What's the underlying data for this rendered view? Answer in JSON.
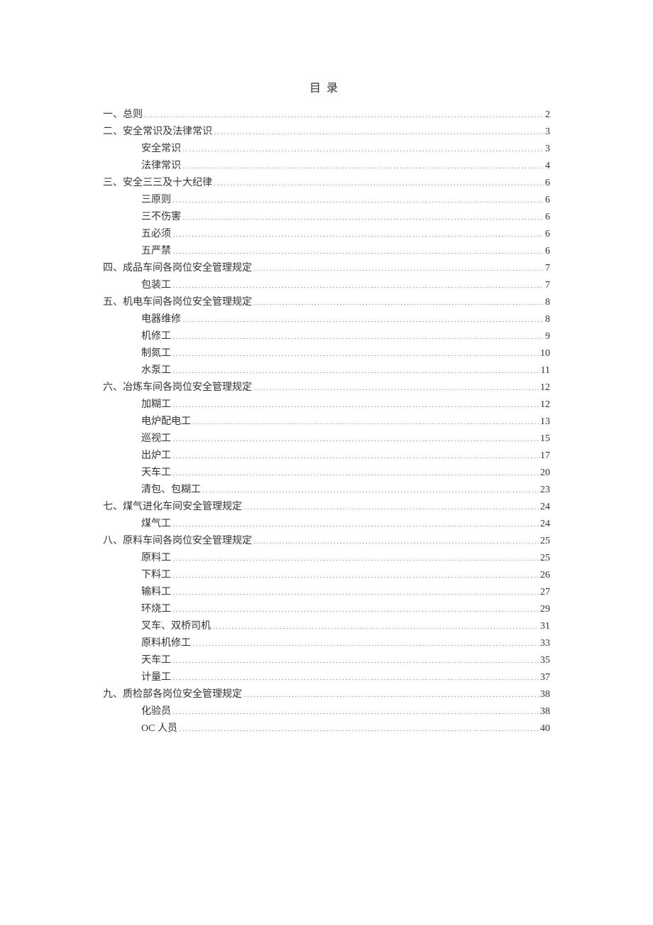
{
  "title": "目录",
  "entries": [
    {
      "level": 1,
      "prefix": "一、",
      "label": "总则",
      "page": "2"
    },
    {
      "level": 1,
      "prefix": "二、",
      "label": "安全常识及法律常识",
      "page": "3"
    },
    {
      "level": 2,
      "prefix": "",
      "label": "安全常识",
      "page": "3"
    },
    {
      "level": 2,
      "prefix": "",
      "label": "法律常识",
      "page": "4"
    },
    {
      "level": 1,
      "prefix": "三、",
      "label": "安全三三及十大纪律",
      "page": "6"
    },
    {
      "level": 2,
      "prefix": "",
      "label": "三原则",
      "page": "6"
    },
    {
      "level": 2,
      "prefix": "",
      "label": "三不伤害",
      "page": "6"
    },
    {
      "level": 2,
      "prefix": "",
      "label": "五必须",
      "page": "6"
    },
    {
      "level": 2,
      "prefix": "",
      "label": "五严禁",
      "page": "6"
    },
    {
      "level": 1,
      "prefix": "四、",
      "label": "成品车间各岗位安全管理规定",
      "page": "7"
    },
    {
      "level": 2,
      "prefix": "",
      "label": "包装工",
      "page": "7"
    },
    {
      "level": 1,
      "prefix": "五、",
      "label": "机电车间各岗位安全管理规定",
      "page": "8"
    },
    {
      "level": 2,
      "prefix": "",
      "label": "电器维修",
      "page": "8"
    },
    {
      "level": 2,
      "prefix": "",
      "label": "机修工",
      "page": "9"
    },
    {
      "level": 2,
      "prefix": "",
      "label": "制氮工",
      "page": "10"
    },
    {
      "level": 2,
      "prefix": "",
      "label": "水泵工",
      "page": "11"
    },
    {
      "level": 1,
      "prefix": "六、",
      "label": "冶炼车间各岗位安全管理规定",
      "page": "12"
    },
    {
      "level": 2,
      "prefix": "",
      "label": "加糊工",
      "page": "12"
    },
    {
      "level": 2,
      "prefix": "",
      "label": "电炉配电工",
      "page": "13"
    },
    {
      "level": 2,
      "prefix": "",
      "label": "巡视工",
      "page": "15"
    },
    {
      "level": 2,
      "prefix": "",
      "label": "出炉工",
      "page": "17"
    },
    {
      "level": 2,
      "prefix": "",
      "label": "天车工",
      "page": "20"
    },
    {
      "level": 2,
      "prefix": "",
      "label": "清包、包糊工",
      "page": "23"
    },
    {
      "level": 1,
      "prefix": "七、",
      "label": "煤气进化车间安全管理规定",
      "page": "24"
    },
    {
      "level": 2,
      "prefix": "",
      "label": "煤气工",
      "page": "24"
    },
    {
      "level": 1,
      "prefix": "八、",
      "label": "原料车间各岗位安全管理规定",
      "page": "25"
    },
    {
      "level": 2,
      "prefix": "",
      "label": "原料工",
      "page": "25"
    },
    {
      "level": 2,
      "prefix": "",
      "label": "下料工",
      "page": "26"
    },
    {
      "level": 2,
      "prefix": "",
      "label": "输料工",
      "page": "27"
    },
    {
      "level": 2,
      "prefix": "",
      "label": "环烧工",
      "page": "29"
    },
    {
      "level": 2,
      "prefix": "",
      "label": "叉车、双桥司机",
      "page": "31"
    },
    {
      "level": 2,
      "prefix": "",
      "label": "原料机修工",
      "page": "33"
    },
    {
      "level": 2,
      "prefix": "",
      "label": "天车工",
      "page": "35"
    },
    {
      "level": 2,
      "prefix": "",
      "label": "计量工",
      "page": "37"
    },
    {
      "level": 1,
      "prefix": "九、",
      "label": "质检部各岗位安全管理规定",
      "page": "38"
    },
    {
      "level": 2,
      "prefix": "",
      "label": "化验员",
      "page": "38"
    },
    {
      "level": 2,
      "prefix": "",
      "label": "OC 人员",
      "page": "40"
    }
  ]
}
